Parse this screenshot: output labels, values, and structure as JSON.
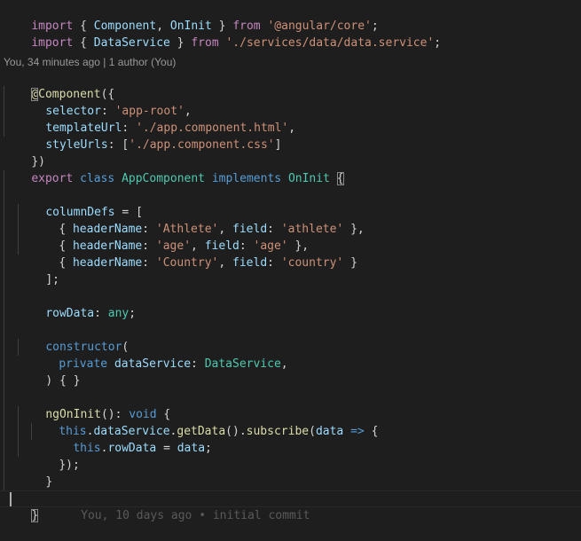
{
  "code": {
    "line_import1": {
      "kw_import": "import",
      "brace_open": " { ",
      "name_component": "Component",
      "comma": ", ",
      "name_oninit": "OnInit",
      "brace_close": " } ",
      "kw_from": "from",
      "space": " ",
      "module": "'@angular/core'",
      "semi": ";"
    },
    "line_import2": {
      "kw_import": "import",
      "brace_open": " { ",
      "name_service": "DataService",
      "brace_close": " } ",
      "kw_from": "from",
      "space": " ",
      "module": "'./services/data/data.service'",
      "semi": ";"
    },
    "codelens": "You, 34 minutes ago | 1 author (You)",
    "line_decorator": {
      "at": "@",
      "name": "Component",
      "open": "({"
    },
    "line_selector": {
      "key": "selector",
      "colon": ": ",
      "value": "'app-root'",
      "comma": ","
    },
    "line_template": {
      "key": "templateUrl",
      "colon": ": ",
      "value": "'./app.component.html'",
      "comma": ","
    },
    "line_styles": {
      "key": "styleUrls",
      "colon": ": [",
      "value": "'./app.component.css'",
      "close": "]"
    },
    "line_decorator_close": "})",
    "line_class": {
      "kw_export": "export",
      "kw_class": "class",
      "name": "AppComponent",
      "kw_implements": "implements",
      "iface": "OnInit",
      "brace": "{"
    },
    "line_coldefs": {
      "name": "columnDefs",
      "rest": " = ["
    },
    "row1": {
      "open": "{ ",
      "k1": "headerName",
      "c1": ": ",
      "v1": "'Athlete'",
      "sep": ", ",
      "k2": "field",
      "c2": ": ",
      "v2": "'athlete'",
      "close": " },"
    },
    "row2": {
      "open": "{ ",
      "k1": "headerName",
      "c1": ": ",
      "v1": "'age'",
      "sep": ", ",
      "k2": "field",
      "c2": ": ",
      "v2": "'age'",
      "close": " },"
    },
    "row3": {
      "open": "{ ",
      "k1": "headerName",
      "c1": ": ",
      "v1": "'Country'",
      "sep": ", ",
      "k2": "field",
      "c2": ": ",
      "v2": "'country'",
      "close": " }"
    },
    "line_coldefs_close": "];",
    "line_rowdata": {
      "name": "rowData",
      "colon": ": ",
      "type": "any",
      "semi": ";"
    },
    "line_ctor": {
      "kw": "constructor",
      "open": "("
    },
    "line_param": {
      "kw": "private",
      "name": "dataService",
      "colon": ": ",
      "type": "DataService",
      "comma": ","
    },
    "line_ctor_close": ") { }",
    "line_ngoninit": {
      "name": "ngOnInit",
      "parens": "(): ",
      "type": "void",
      "brace": " {"
    },
    "line_subscribe": {
      "kw_this": "this",
      "dot1": ".",
      "prop": "dataService",
      "dot2": ".",
      "fn_get": "getData",
      "mid": "().",
      "fn_sub": "subscribe",
      "paren": "(",
      "param": "data",
      "arrow": " => ",
      "brace": "{"
    },
    "line_assign": {
      "kw_this": "this",
      "dot": ".",
      "prop": "rowData",
      "eq": " = ",
      "val": "data",
      "semi": ";"
    },
    "line_sub_close": "});",
    "line_method_close": "}",
    "line_class_close": "}",
    "blame": "You, 10 days ago • initial commit"
  }
}
